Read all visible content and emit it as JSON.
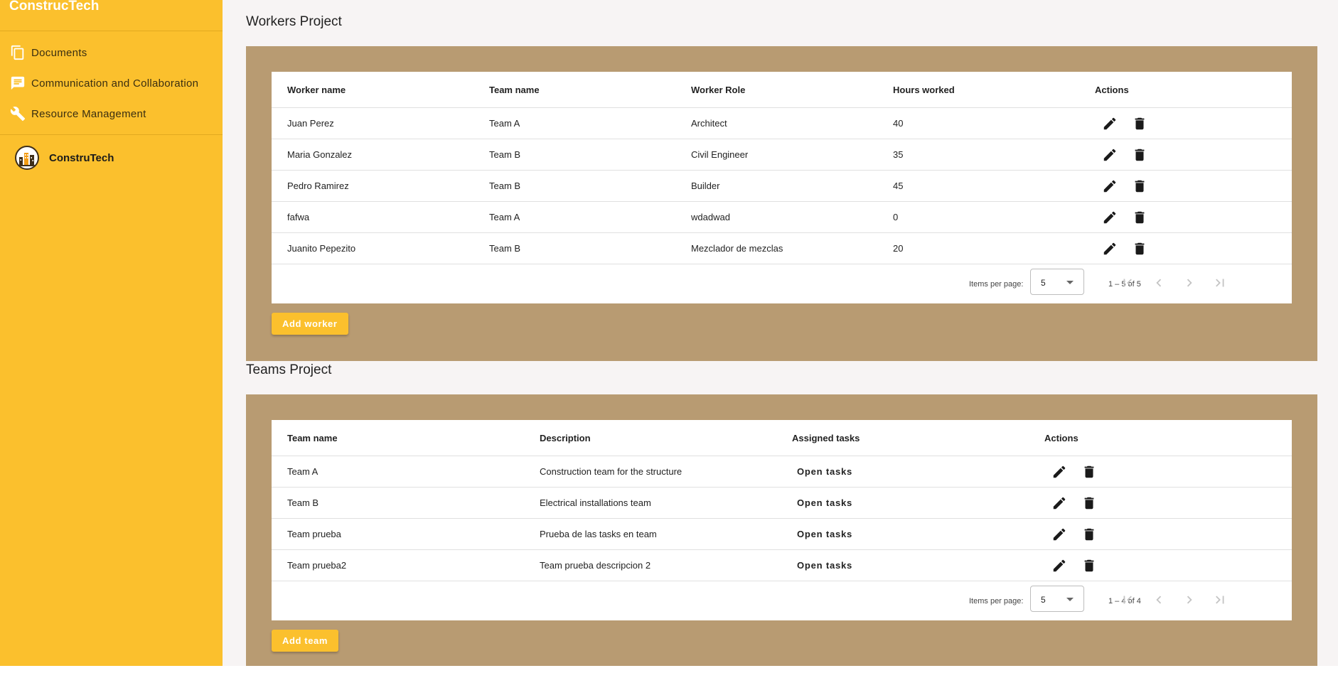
{
  "app": {
    "brand": "ConstrucTech"
  },
  "sidebar": {
    "items": [
      {
        "label": "Documents",
        "icon": "documents-icon"
      },
      {
        "label": "Communication and Collaboration",
        "icon": "chat-icon"
      },
      {
        "label": "Resource Management",
        "icon": "wrench-icon"
      }
    ],
    "profile": {
      "name": "ConstruTech"
    }
  },
  "workers": {
    "title": "Workers Project",
    "columns": [
      "Worker name",
      "Team name",
      "Worker Role",
      "Hours worked",
      "Actions"
    ],
    "rows": [
      [
        "Juan Perez",
        "Team A",
        "Architect",
        "40"
      ],
      [
        "Maria Gonzalez",
        "Team B",
        "Civil Engineer",
        "35"
      ],
      [
        "Pedro Ramirez",
        "Team B",
        "Builder",
        "45"
      ],
      [
        "fafwa",
        "Team A",
        "wdadwad",
        "0"
      ],
      [
        "Juanito Pepezito",
        "Team B",
        "Mezclador de mezclas",
        "20"
      ]
    ],
    "paginator": {
      "label": "Items per page:",
      "page_size": "5",
      "range": "1 – 5 of 5"
    },
    "add_button": "Add worker"
  },
  "teams": {
    "title": "Teams Project",
    "columns": [
      "Team name",
      "Description",
      "Assigned tasks",
      "Actions"
    ],
    "rows": [
      [
        "Team A",
        "Construction team for the structure",
        "Open tasks"
      ],
      [
        "Team B",
        "Electrical installations team",
        "Open tasks"
      ],
      [
        "Team prueba",
        "Prueba de las tasks en team",
        "Open tasks"
      ],
      [
        "Team prueba2",
        "Team prueba descripcion 2",
        "Open tasks"
      ]
    ],
    "paginator": {
      "label": "Items per page:",
      "page_size": "5",
      "range": "1 – 4 of 4"
    },
    "add_button": "Add team"
  },
  "colors": {
    "sidebar": "#fbc02d",
    "panel": "#b89b72",
    "accent": "#fbc02d",
    "background": "#f7f4f4"
  }
}
